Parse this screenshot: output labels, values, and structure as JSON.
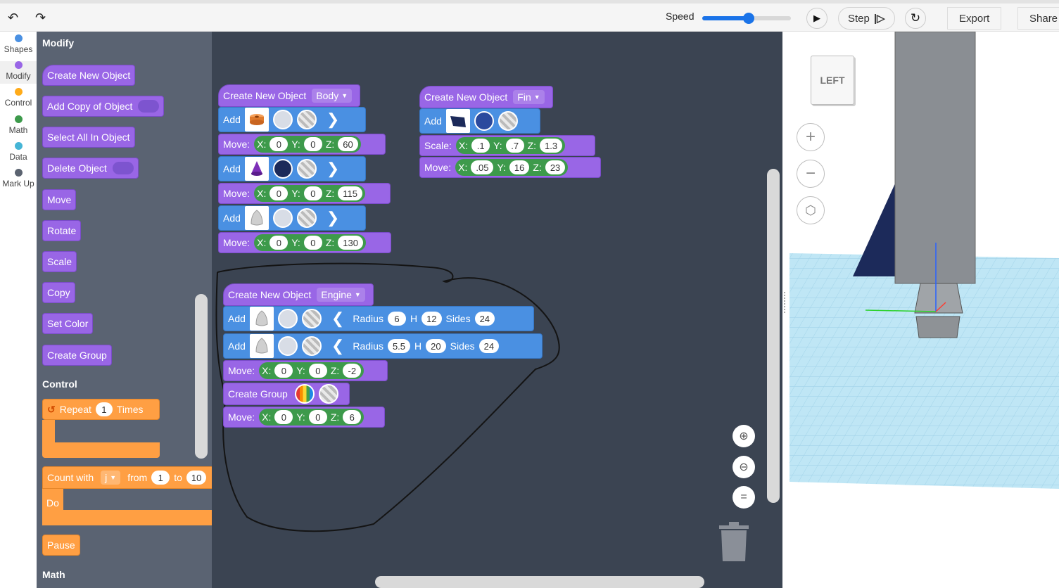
{
  "toolbar": {
    "undo_icon": "undo-arrow",
    "redo_icon": "redo-arrow",
    "speed_label": "Speed",
    "speed_value": 0.52,
    "step_label": "Step",
    "export_label": "Export",
    "share_label": "Share"
  },
  "categories": [
    {
      "label": "Shapes",
      "color": "#4a90e2"
    },
    {
      "label": "Modify",
      "color": "#9966e6"
    },
    {
      "label": "Control",
      "color": "#ffab19"
    },
    {
      "label": "Math",
      "color": "#3d9a4b"
    },
    {
      "label": "Data",
      "color": "#45b5d6"
    },
    {
      "label": "Mark Up",
      "color": "#5b6370"
    }
  ],
  "flyout": {
    "modify_title": "Modify",
    "modify_blocks": [
      "Create New Object",
      "Add Copy of Object",
      "Select All In Object",
      "Delete Object",
      "Move",
      "Rotate",
      "Scale",
      "Copy",
      "Set Color",
      "Create Group"
    ],
    "control_title": "Control",
    "repeat": {
      "label": "Repeat",
      "count": "1",
      "suffix": "Times"
    },
    "count_with": {
      "label": "Count with",
      "var": "j",
      "from_label": "from",
      "from": "1",
      "to_label": "to",
      "to": "10",
      "do_label": "Do"
    },
    "pause_label": "Pause",
    "math_title": "Math"
  },
  "workspace": {
    "body": {
      "title": "Create New Object",
      "name": "Body",
      "add_label": "Add",
      "move_label": "Move:",
      "moves": [
        {
          "x": "0",
          "y": "0",
          "z": "60"
        },
        {
          "x": "0",
          "y": "0",
          "z": "115"
        },
        {
          "x": "0",
          "y": "0",
          "z": "130"
        }
      ]
    },
    "fin": {
      "title": "Create New Object",
      "name": "Fin",
      "add_label": "Add",
      "scale_label": "Scale:",
      "scale": {
        "x": ".1",
        "y": ".7",
        "z": "1.3"
      },
      "move_label": "Move:",
      "move": {
        "x": ".05",
        "y": "16",
        "z": "23"
      }
    },
    "engine": {
      "title": "Create New Object",
      "name": "Engine",
      "add_label": "Add",
      "radius_label": "Radius",
      "h_label": "H",
      "sides_label": "Sides",
      "cone1": {
        "radius": "6",
        "h": "12",
        "sides": "24"
      },
      "cone2": {
        "radius": "5.5",
        "h": "20",
        "sides": "24"
      },
      "move_label": "Move:",
      "move1": {
        "x": "0",
        "y": "0",
        "z": "-2"
      },
      "group_label": "Create Group",
      "move2": {
        "x": "0",
        "y": "0",
        "z": "6"
      }
    },
    "axis_labels": {
      "x": "X:",
      "y": "Y:",
      "z": "Z:"
    }
  },
  "view3d": {
    "view_cube_label": "LEFT"
  },
  "colors": {
    "modify_purple": "#9966e6",
    "add_blue": "#4a90e2",
    "move_green": "#3d9a4b",
    "control_orange": "#ff9f43",
    "workspace_bg": "#3b4452",
    "flyout_bg": "#5a6372",
    "grid_cyan": "#bfe6f5"
  }
}
